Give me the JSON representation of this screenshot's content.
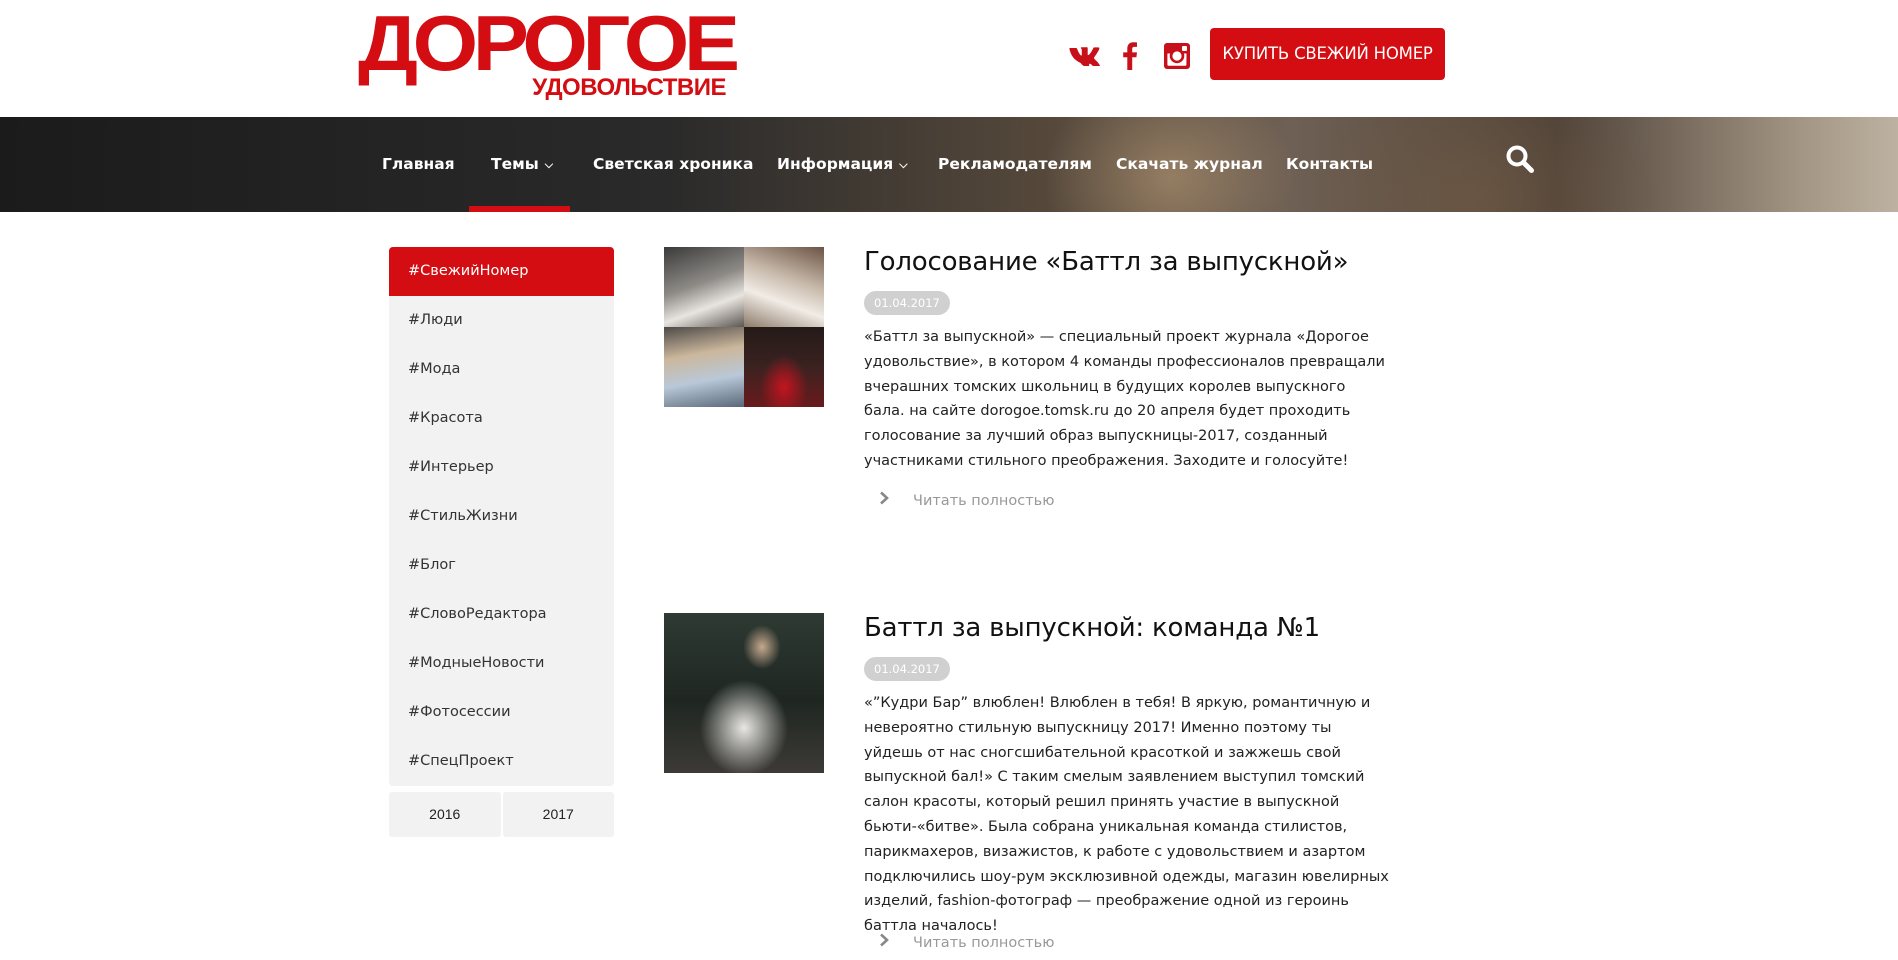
{
  "brand": {
    "logo_main": "ДОРОГОЕ",
    "logo_sub": "УДОВОЛЬСТВИЕ",
    "accent_color": "#d40d12"
  },
  "header": {
    "social": [
      {
        "name": "vk-icon"
      },
      {
        "name": "facebook-icon"
      },
      {
        "name": "instagram-icon"
      }
    ],
    "buy_label": "КУПИТЬ СВЕЖИЙ НОМЕР"
  },
  "nav": {
    "items": [
      {
        "label": "Главная",
        "dropdown": false
      },
      {
        "label": "Темы",
        "dropdown": true,
        "active": true
      },
      {
        "label": "Светская хроника",
        "dropdown": false
      },
      {
        "label": "Информация",
        "dropdown": true
      },
      {
        "label": "Рекламодателям",
        "dropdown": false
      },
      {
        "label": "Скачать журнал",
        "dropdown": false
      },
      {
        "label": "Контакты",
        "dropdown": false
      }
    ],
    "caret_glyph": "⌵",
    "search_icon": "search-icon"
  },
  "sidebar": {
    "items": [
      {
        "label": "#СвежийНомер",
        "active": true
      },
      {
        "label": "#Люди"
      },
      {
        "label": "#Мода"
      },
      {
        "label": "#Красота"
      },
      {
        "label": "#Интерьер"
      },
      {
        "label": "#СтильЖизни"
      },
      {
        "label": "#Блог"
      },
      {
        "label": "#СловоРедактора"
      },
      {
        "label": "#МодныеНовости"
      },
      {
        "label": "#Фотосессии"
      },
      {
        "label": "#СпецПроект"
      }
    ],
    "years": [
      "2016",
      "2017"
    ]
  },
  "articles": [
    {
      "title": "Голосование «Баттл за выпускной»",
      "date": "01.04.2017",
      "text": "«Баттл за выпускной» — специальный проект журнала «Дорогое удовольствие», в котором 4 команды профессионалов превращали вчерашних томских школьниц в будущих королев выпускного бала. на сайте dorogoe.tomsk.ru до 20 апреля будет проходить голосование за лучший образ выпускницы-2017, созданный участниками стильного преображения. Заходите и голосуйте!",
      "read_more": "Читать полностью"
    },
    {
      "title": "Баттл за выпускной: команда №1",
      "date": "01.04.2017",
      "text": "«”Кудри Бар” влюблен! Влюблен в тебя! В яркую, романтичную и невероятно стильную выпускницу 2017! Именно поэтому ты уйдешь от нас сногсшибательной красоткой и зажжешь свой выпускной бал!» С таким смелым заявлением выступил томский салон красоты, который решил принять участие в выпускной бьюти-«битве». Была собрана уникальная команда стилистов, парикмахеров, визажистов, к работе с удовольствием и азартом подключились шоу-рум эксклюзивной одежды, магазин ювелирных изделий, fashion-фотограф — преображение одной из героинь баттла началось!",
      "read_more": "Читать полностью"
    }
  ]
}
